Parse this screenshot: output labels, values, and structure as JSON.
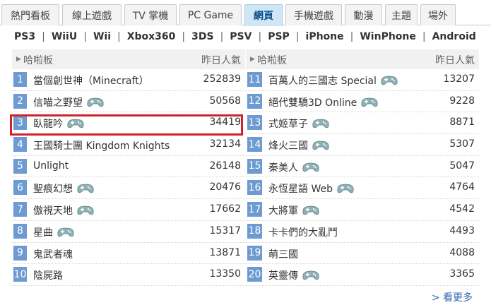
{
  "tabs": [
    {
      "label": "熱門看板"
    },
    {
      "label": "線上遊戲"
    },
    {
      "label": "TV 掌機"
    },
    {
      "label": "PC Game"
    },
    {
      "label": "網頁"
    },
    {
      "label": "手機遊戲"
    },
    {
      "label": "動漫"
    },
    {
      "label": "主題"
    },
    {
      "label": "場外"
    }
  ],
  "platforms": [
    "PS3",
    "WiiU",
    "Wii",
    "Xbox360",
    "3DS",
    "PSV",
    "PSP",
    "iPhone",
    "WinPhone",
    "Android"
  ],
  "columns": {
    "left": {
      "header_name": "哈啦板",
      "header_heat": "昨日人氣",
      "rows": [
        {
          "rank": "1",
          "name": "當個創世神（Minecraft）",
          "count": "252839"
        },
        {
          "rank": "2",
          "name": "信喵之野望",
          "count": "50568"
        },
        {
          "rank": "3",
          "name": "臥龍吟",
          "count": "34419"
        },
        {
          "rank": "4",
          "name": "王國騎士團 Kingdom Knights",
          "count": "32134"
        },
        {
          "rank": "5",
          "name": "Unlight",
          "count": "26148"
        },
        {
          "rank": "6",
          "name": "聖痕幻想",
          "count": "20476"
        },
        {
          "rank": "7",
          "name": "傲視天地",
          "count": "17662"
        },
        {
          "rank": "8",
          "name": "星曲",
          "count": "15317"
        },
        {
          "rank": "9",
          "name": "鬼武者魂",
          "count": "13871"
        },
        {
          "rank": "10",
          "name": "陰屍路",
          "count": "13350"
        }
      ]
    },
    "right": {
      "header_name": "哈啦板",
      "header_heat": "昨日人氣",
      "rows": [
        {
          "rank": "11",
          "name": "百萬人的三國志 Special",
          "count": "13207"
        },
        {
          "rank": "12",
          "name": "絕代雙驕3D Online",
          "count": "9228"
        },
        {
          "rank": "13",
          "name": "式姬草子",
          "count": "8871"
        },
        {
          "rank": "14",
          "name": "烽火三國",
          "count": "5307"
        },
        {
          "rank": "15",
          "name": "秦美人",
          "count": "5047"
        },
        {
          "rank": "16",
          "name": "永恆星語 Web",
          "count": "4764"
        },
        {
          "rank": "17",
          "name": "大將軍",
          "count": "4542"
        },
        {
          "rank": "18",
          "name": "卡卡們的大亂鬥",
          "count": "4493"
        },
        {
          "rank": "19",
          "name": "萌三國",
          "count": "4088"
        },
        {
          "rank": "20",
          "name": "英靈傳",
          "count": "3365"
        }
      ]
    }
  },
  "more_label": "> 看更多",
  "colors": {
    "rank_bg": "#6d9bd1",
    "active_tab_bg": "#cfe6f4",
    "highlight": "#d3202a",
    "link": "#2b67ad"
  }
}
